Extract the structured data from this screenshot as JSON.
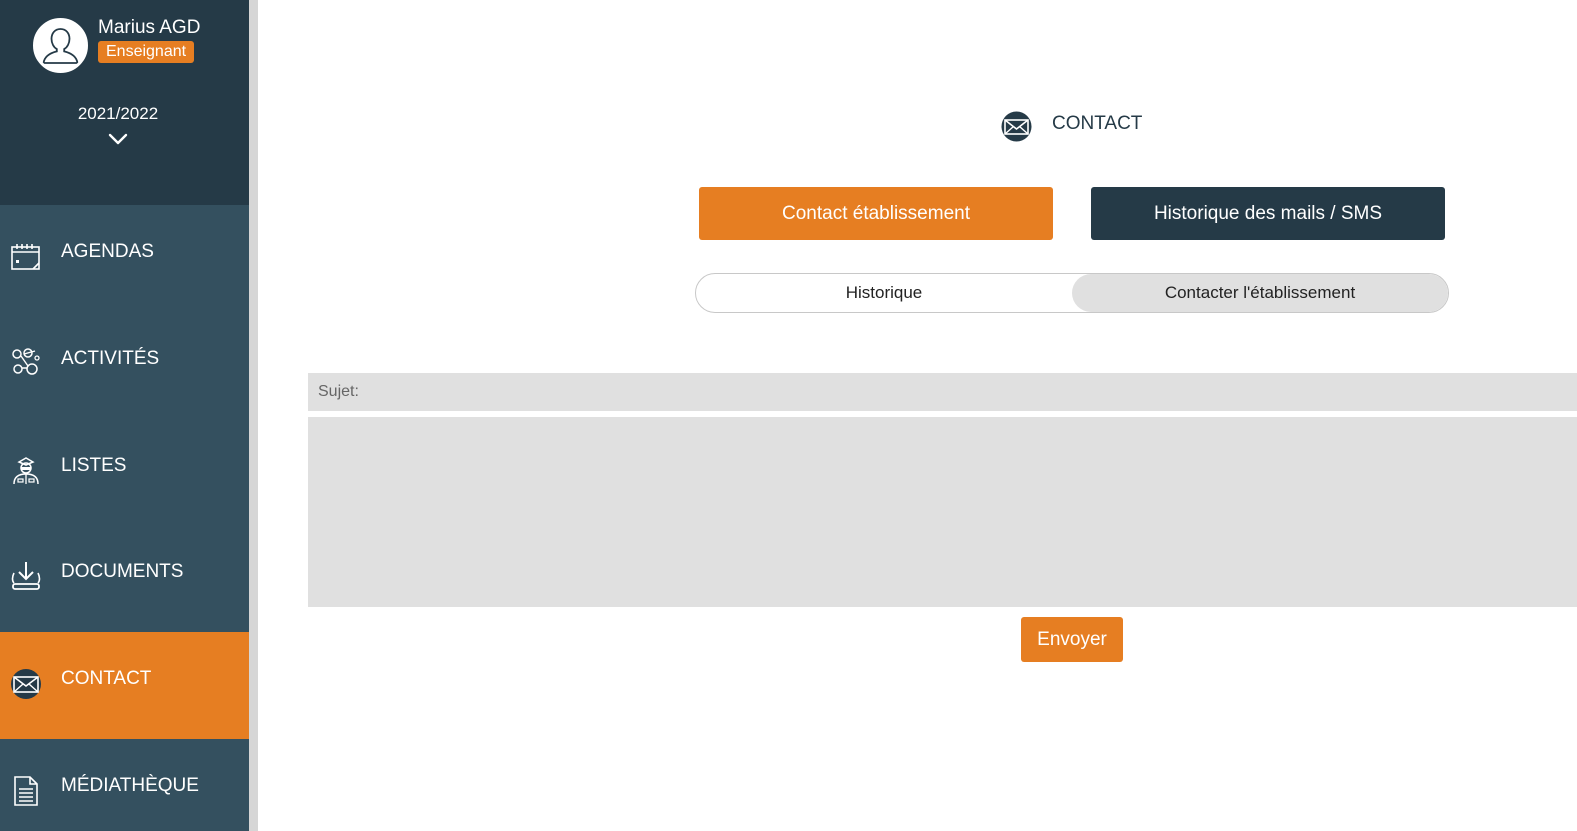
{
  "user": {
    "name": "Marius AGD",
    "role": "Enseignant",
    "avatar_icon": "user-avatar-icon"
  },
  "school_year": {
    "value": "2021/2022",
    "icon": "chevron-down-icon"
  },
  "sidebar": {
    "items": [
      {
        "label": "AGENDAS",
        "icon": "calendar-icon",
        "active": false
      },
      {
        "label": "ACTIVITÉS",
        "icon": "activities-icon",
        "active": false
      },
      {
        "label": "LISTES",
        "icon": "students-icon",
        "active": false
      },
      {
        "label": "DOCUMENTS",
        "icon": "download-icon",
        "active": false
      },
      {
        "label": "CONTACT",
        "icon": "envelope-icon",
        "active": true
      },
      {
        "label": "MÉDIATHÈQUE",
        "icon": "document-icon",
        "active": false
      }
    ]
  },
  "header": {
    "title": "CONTACT",
    "icon": "envelope-icon"
  },
  "actions": {
    "contact_label": "Contact établissement",
    "history_label": "Historique des mails / SMS"
  },
  "tabs": {
    "items": [
      {
        "label": "Historique",
        "selected": false
      },
      {
        "label": "Contacter l'établissement",
        "selected": true
      }
    ]
  },
  "form": {
    "subject_placeholder": "Sujet:",
    "subject_value": "",
    "message_value": "",
    "send_label": "Envoyer"
  },
  "colors": {
    "accent": "#e67e22",
    "sidebar": "#34505f",
    "sidebar_dark": "#253a47",
    "field_bg": "#e0e0e0"
  }
}
